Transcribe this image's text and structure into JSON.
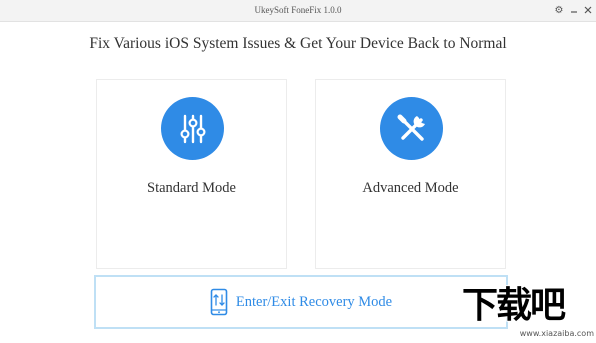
{
  "window": {
    "title": "UkeySoft FoneFix 1.0.0"
  },
  "headline": "Fix Various iOS System Issues & Get Your Device Back to Normal",
  "modes": {
    "standard": {
      "label": "Standard Mode",
      "icon": "sliders-icon"
    },
    "advanced": {
      "label": "Advanced Mode",
      "icon": "tools-icon"
    }
  },
  "recovery": {
    "label": "Enter/Exit Recovery Mode",
    "icon": "phone-arrows-icon"
  },
  "watermark": {
    "logo": "下载吧",
    "url": "www.xiazaiba.com"
  },
  "colors": {
    "accent": "#2f8be6",
    "border": "#ececec",
    "recovery_border": "#bfe0f5"
  }
}
